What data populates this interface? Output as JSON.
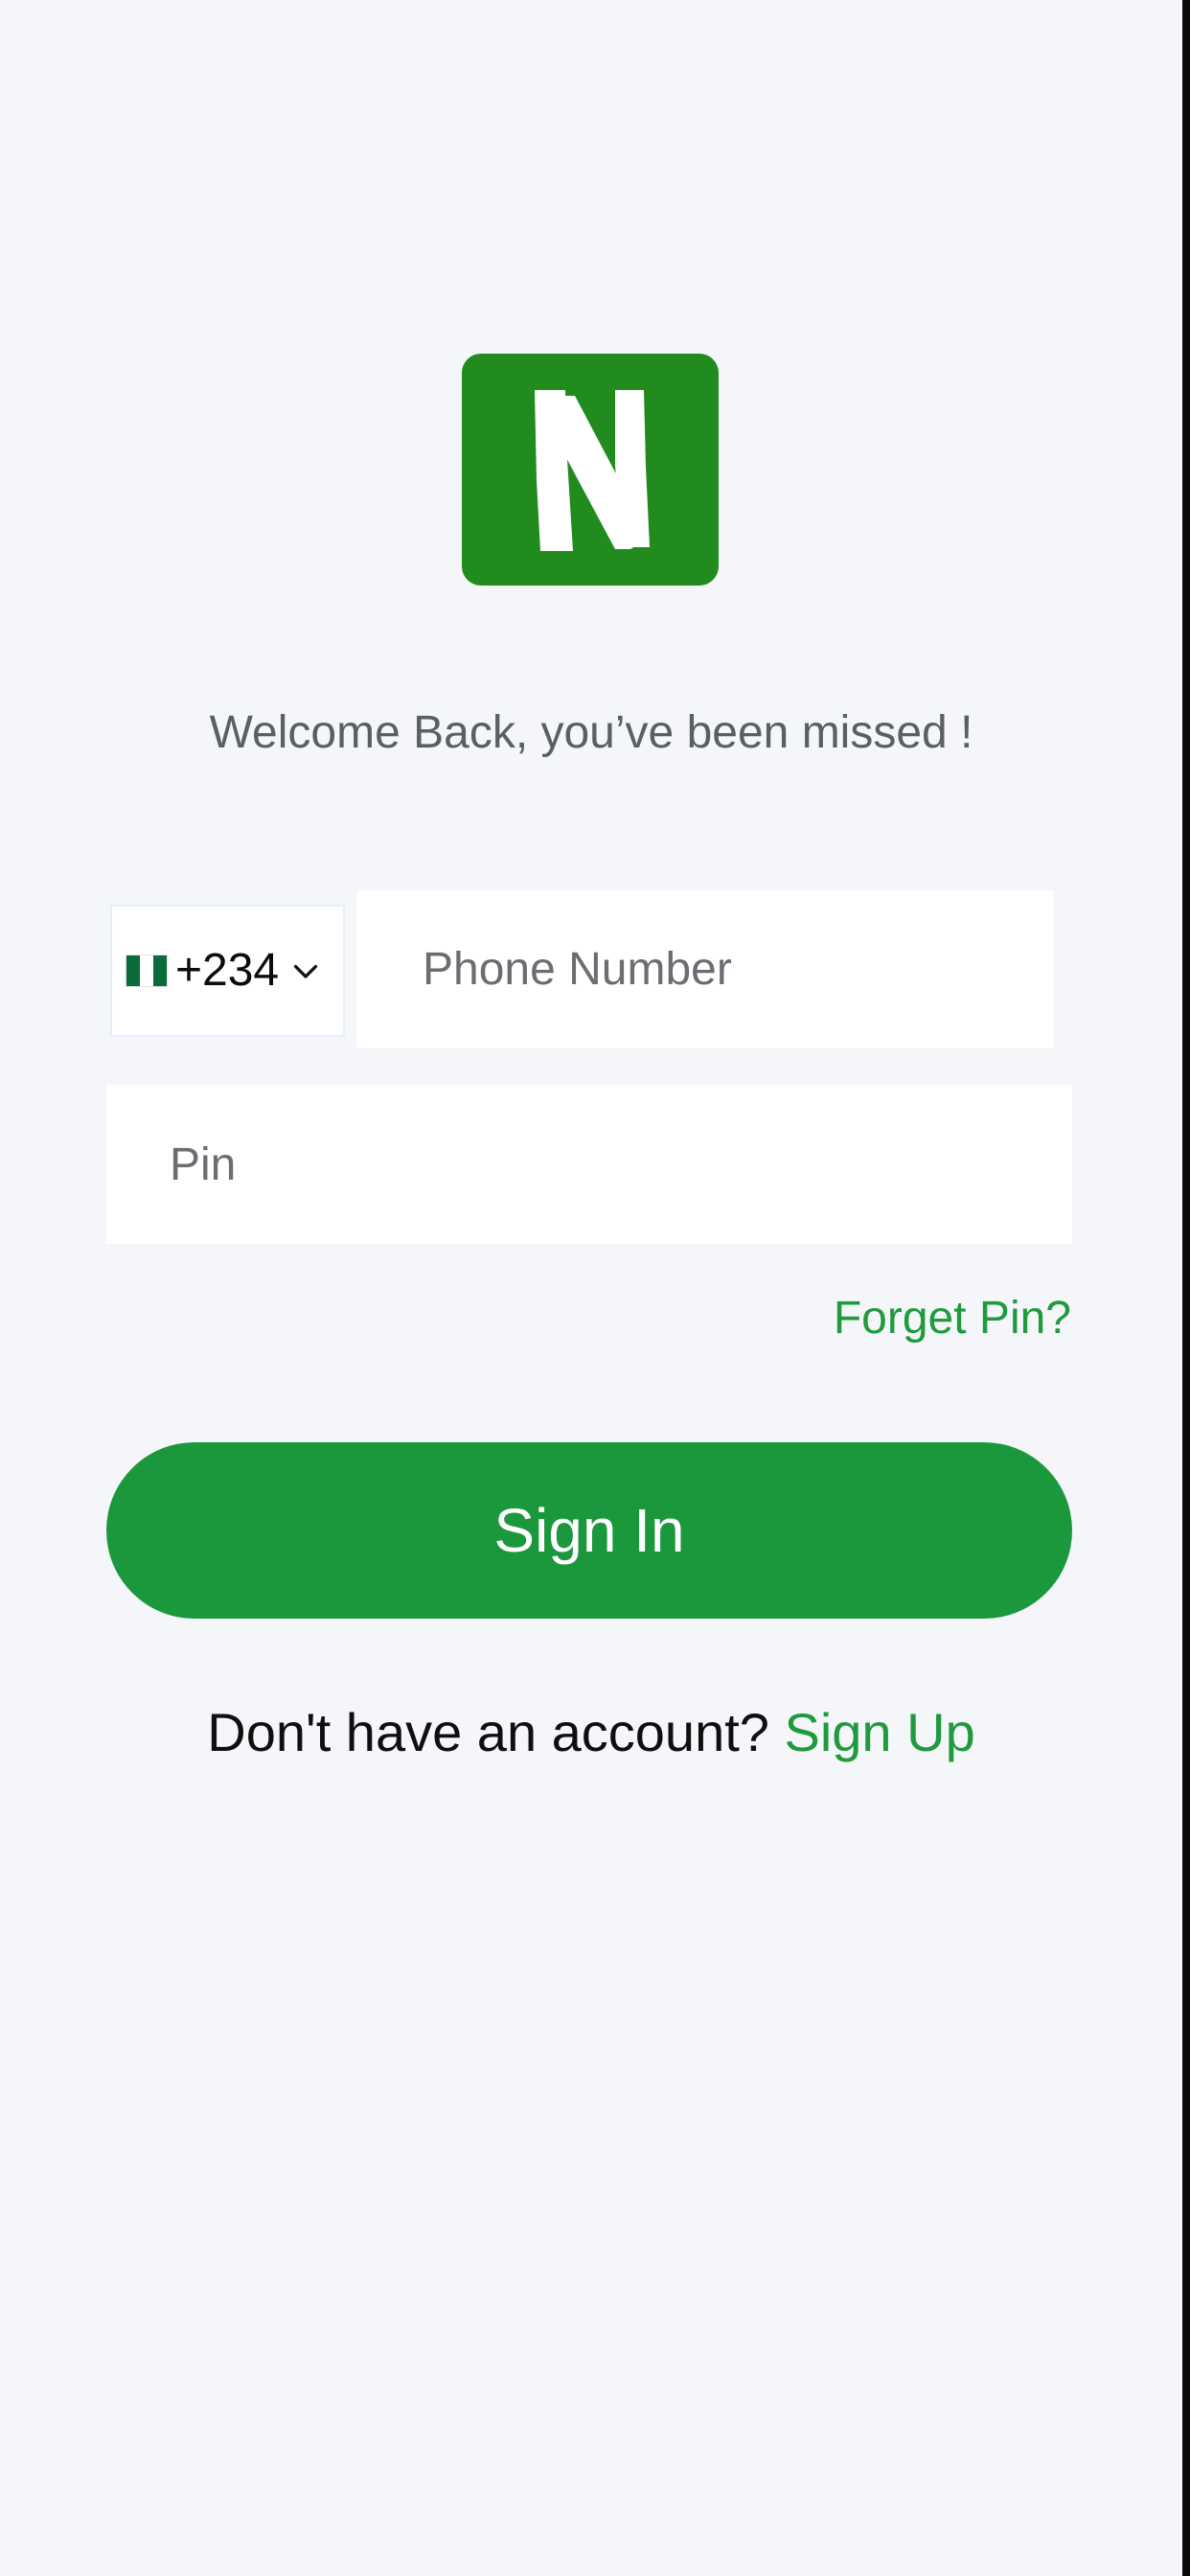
{
  "brand": {
    "logo_icon": "n-letter-logo-icon",
    "accent": "#218b1e"
  },
  "welcome_text": "Welcome Back, you’ve been missed !",
  "country": {
    "flag_icon": "nigeria-flag-icon",
    "dial_code": "+234",
    "chevron_icon": "chevron-down-icon"
  },
  "phone": {
    "placeholder": "Phone Number"
  },
  "pin": {
    "placeholder": "Pin"
  },
  "forgot_pin_label": "Forget Pin?",
  "sign_in_label": "Sign In",
  "no_account_text": "Don't have an account? ",
  "sign_up_label": "Sign Up",
  "colors": {
    "primary": "#1b983c",
    "link": "#1f9a3d",
    "background": "#f4f6f9"
  }
}
